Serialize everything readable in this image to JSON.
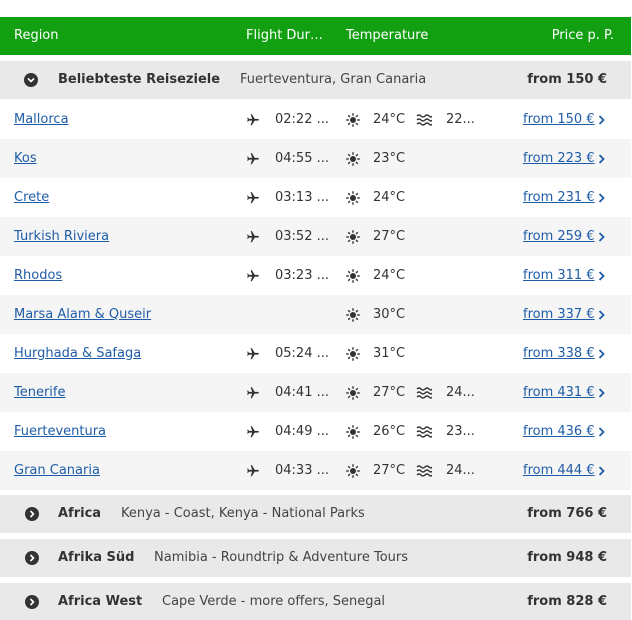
{
  "header": {
    "region": "Region",
    "flight": "Flight Duration",
    "temperature": "Temperature",
    "price": "Price p. P."
  },
  "groups": [
    {
      "name": "Beliebteste Reiseziele",
      "subtitle": "Fuerteventura, Gran Canaria",
      "price": "from 150 €",
      "expanded": true
    },
    {
      "name": "Africa",
      "subtitle": "Kenya - Coast, Kenya - National Parks",
      "price": "from 766 €",
      "expanded": false
    },
    {
      "name": "Afrika Süd",
      "subtitle": "Namibia - Roundtrip & Adventure Tours",
      "price": "from 948 €",
      "expanded": false
    },
    {
      "name": "Africa West",
      "subtitle": "Cape Verde - more offers, Senegal",
      "price": "from 828 €",
      "expanded": false
    }
  ],
  "rows": [
    {
      "name": "Mallorca",
      "flight": "02:22 ...",
      "temp": "24°C",
      "water": "22...",
      "price": "from 150 €"
    },
    {
      "name": "Kos",
      "flight": "04:55 ...",
      "temp": "23°C",
      "water": "",
      "price": "from 223 €"
    },
    {
      "name": "Crete",
      "flight": "03:13 ...",
      "temp": "24°C",
      "water": "",
      "price": "from 231 €"
    },
    {
      "name": "Turkish Riviera",
      "flight": "03:52 ...",
      "temp": "27°C",
      "water": "",
      "price": "from 259 €"
    },
    {
      "name": "Rhodos",
      "flight": "03:23 ...",
      "temp": "24°C",
      "water": "",
      "price": "from 311 €"
    },
    {
      "name": "Marsa Alam & Quseir",
      "flight": "",
      "temp": "30°C",
      "water": "",
      "price": "from 337 €"
    },
    {
      "name": "Hurghada & Safaga",
      "flight": "05:24 ...",
      "temp": "31°C",
      "water": "",
      "price": "from 338 €"
    },
    {
      "name": "Tenerife",
      "flight": "04:41 ...",
      "temp": "27°C",
      "water": "24...",
      "price": "from 431 €"
    },
    {
      "name": "Fuerteventura",
      "flight": "04:49 ...",
      "temp": "26°C",
      "water": "23...",
      "price": "from 436 €"
    },
    {
      "name": "Gran Canaria",
      "flight": "04:33 ...",
      "temp": "27°C",
      "water": "24...",
      "price": "from 444 €"
    }
  ],
  "icons": {
    "flight": "airplane-icon",
    "temperature": "sun-icon",
    "water": "waves-icon",
    "group_toggle": "chevron-circle-icon",
    "price_link": "chevron-right-icon"
  },
  "colors": {
    "header_bg": "#12a012",
    "link": "#1f5ca8",
    "group_bg": "#e9e9e9",
    "row_alt_bg": "#f5f5f5"
  }
}
